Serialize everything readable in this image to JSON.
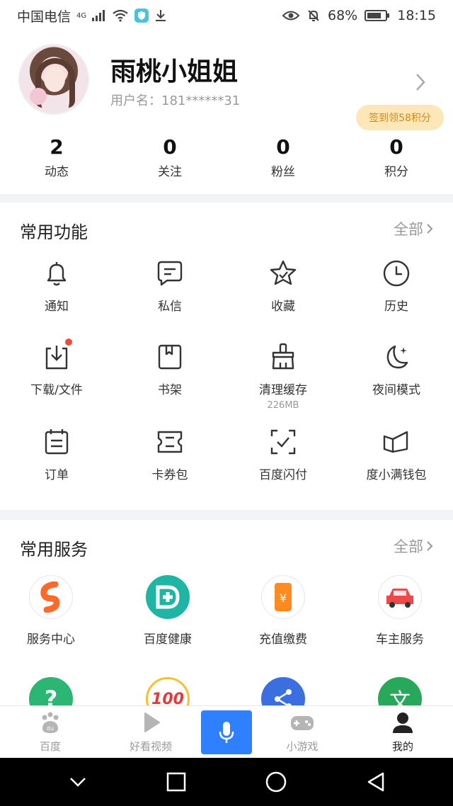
{
  "status": {
    "carrier": "中国电信",
    "network": "4G",
    "battery": "68%",
    "time": "18:15"
  },
  "profile": {
    "nickname": "雨桃小姐姐",
    "username": "用户名：181******31",
    "checkin_badge": "签到领58积分",
    "stats": [
      {
        "value": "2",
        "label": "动态"
      },
      {
        "value": "0",
        "label": "关注"
      },
      {
        "value": "0",
        "label": "粉丝"
      },
      {
        "value": "0",
        "label": "积分"
      }
    ]
  },
  "functions": {
    "title": "常用功能",
    "more": "全部",
    "items": [
      {
        "label": "通知",
        "icon": "bell-icon"
      },
      {
        "label": "私信",
        "icon": "message-icon"
      },
      {
        "label": "收藏",
        "icon": "star-icon"
      },
      {
        "label": "历史",
        "icon": "clock-icon"
      },
      {
        "label": "下载/文件",
        "icon": "download-icon"
      },
      {
        "label": "书架",
        "icon": "bookshelf-icon"
      },
      {
        "label": "清理缓存",
        "sub": "226MB",
        "icon": "broom-icon"
      },
      {
        "label": "夜间模式",
        "icon": "moon-icon"
      },
      {
        "label": "订单",
        "icon": "order-icon"
      },
      {
        "label": "卡券包",
        "icon": "coupon-icon"
      },
      {
        "label": "百度闪付",
        "icon": "scan-pay-icon"
      },
      {
        "label": "度小满钱包",
        "icon": "wallet-icon"
      }
    ]
  },
  "services": {
    "title": "常用服务",
    "more": "全部",
    "items": [
      {
        "label": "服务中心",
        "icon": "service-center-icon"
      },
      {
        "label": "百度健康",
        "icon": "health-icon"
      },
      {
        "label": "充值缴费",
        "icon": "recharge-icon"
      },
      {
        "label": "车主服务",
        "icon": "car-icon"
      }
    ],
    "second_row": [
      {
        "icon": "help-icon",
        "text": "?"
      },
      {
        "icon": "score-100-icon",
        "text": "100"
      },
      {
        "icon": "share-icon"
      },
      {
        "icon": "translate-icon",
        "text": "文"
      }
    ]
  },
  "tabbar": {
    "items": [
      {
        "label": "百度",
        "icon": "baidu-paw-icon"
      },
      {
        "label": "好看视频",
        "icon": "play-icon"
      },
      {
        "label": "小游戏",
        "icon": "gamepad-icon"
      },
      {
        "label": "我的",
        "icon": "profile-icon"
      }
    ]
  },
  "colors": {
    "accent": "#2f80ff",
    "badge_bg": "#fde6b8",
    "badge_text": "#d48a1c",
    "dot": "#f04b3a"
  }
}
